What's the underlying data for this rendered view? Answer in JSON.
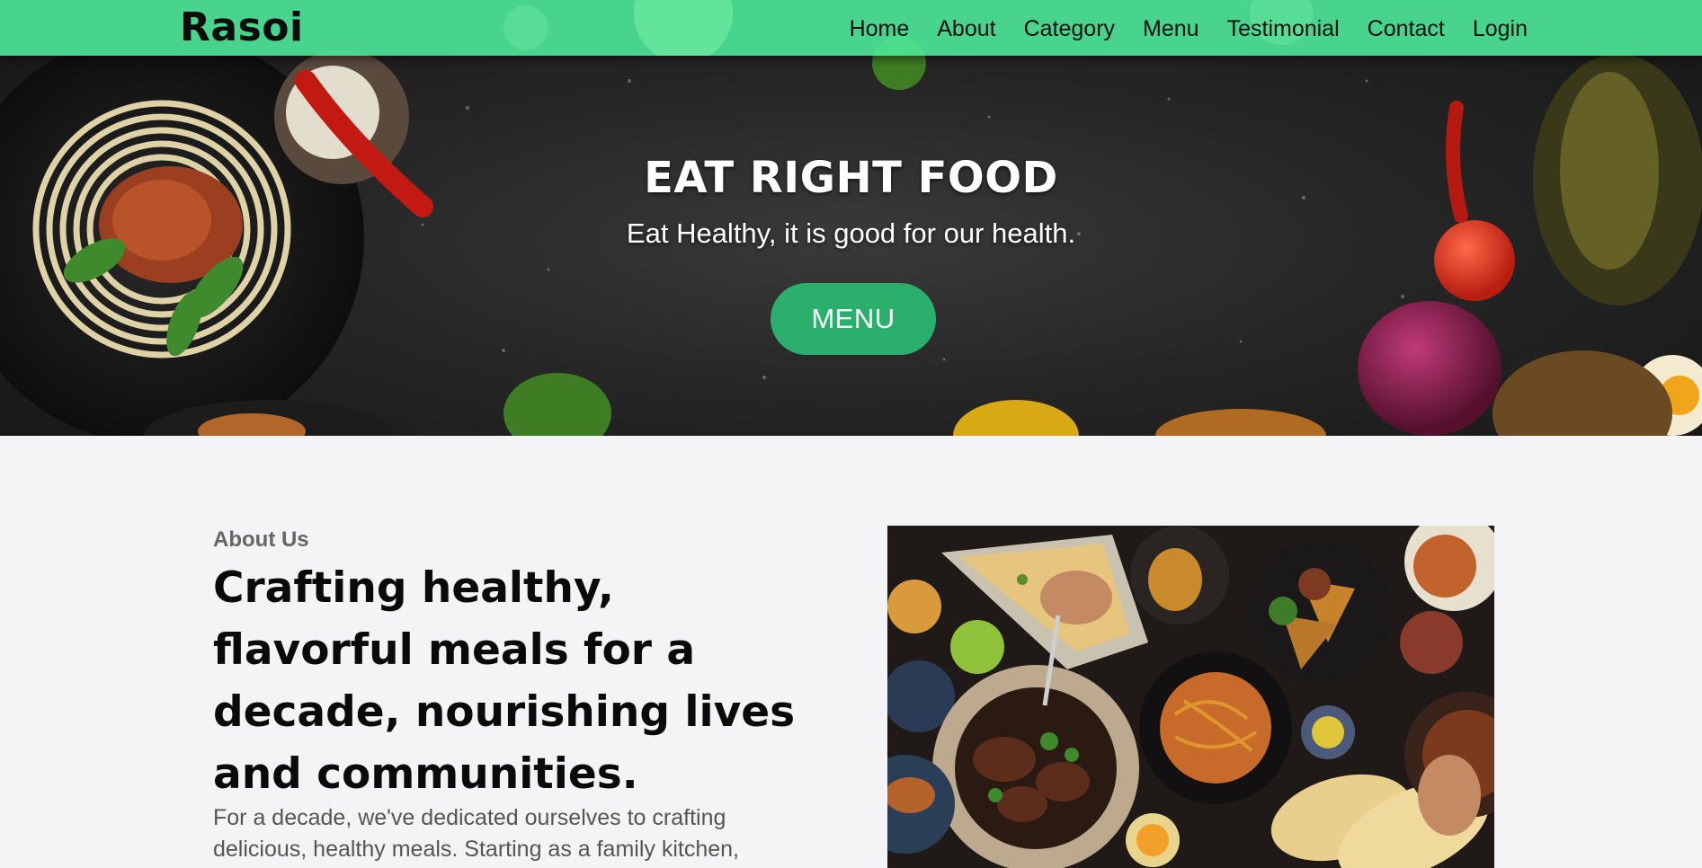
{
  "brand": {
    "logo": "Rasoi",
    "accent": "#4ce496",
    "button_color": "#2ab06c"
  },
  "nav": {
    "items": [
      {
        "label": "Home"
      },
      {
        "label": "About"
      },
      {
        "label": "Category"
      },
      {
        "label": "Menu"
      },
      {
        "label": "Testimonial"
      },
      {
        "label": "Contact"
      },
      {
        "label": "Login"
      }
    ]
  },
  "hero": {
    "title": "EAT RIGHT FOOD",
    "subtitle": "Eat Healthy, it is good for our health.",
    "button_label": "MENU"
  },
  "about": {
    "eyebrow": "About Us",
    "heading": "Crafting healthy, flavorful meals for a decade, nourishing lives and communities.",
    "body": "For a decade, we've dedicated ourselves to crafting delicious, healthy meals. Starting as a family kitchen,"
  }
}
